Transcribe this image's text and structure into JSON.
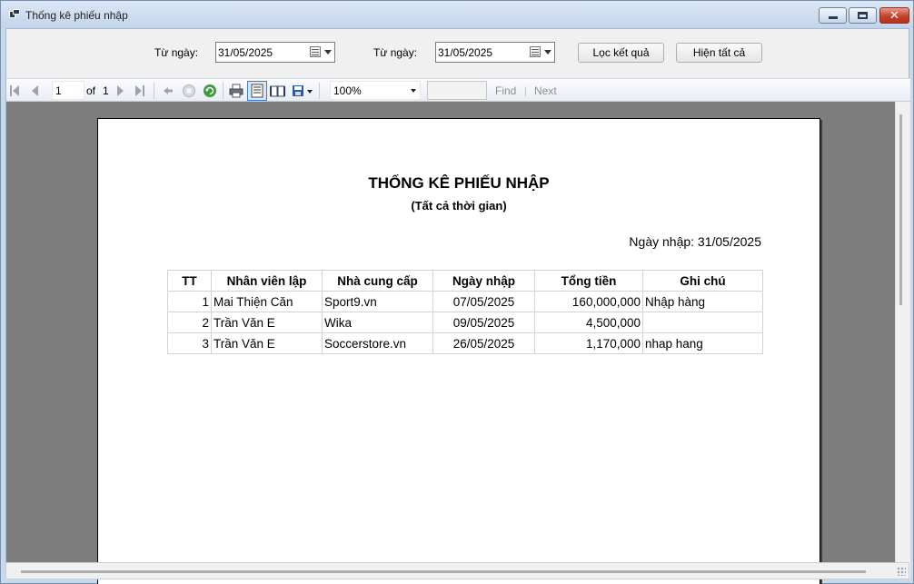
{
  "window": {
    "title": "Thống kê phiếu nhập"
  },
  "filters": {
    "from_label": "Từ ngày:",
    "from_value": "31/05/2025",
    "to_label": "Từ ngày:",
    "to_value": "31/05/2025",
    "filter_button": "Lọc kết quả",
    "show_all_button": "Hiện tất cả"
  },
  "toolbar": {
    "page_current": "1",
    "page_of_label": "of",
    "page_total": "1",
    "zoom": "100%",
    "find_label": "Find",
    "find_sep": "|",
    "next_label": "Next",
    "icons": [
      "first-page-icon",
      "prev-page-icon",
      "next-page-icon",
      "last-page-icon",
      "back-icon",
      "stop-icon",
      "refresh-icon",
      "print-icon",
      "print-layout-icon",
      "page-setup-icon",
      "export-icon"
    ]
  },
  "report": {
    "title": "THỐNG KÊ PHIẾU NHẬP",
    "subtitle": "(Tất cả thời gian)",
    "date_line": "Ngày nhập: 31/05/2025",
    "columns": [
      "TT",
      "Nhân viên lập",
      "Nhà cung cấp",
      "Ngày nhập",
      "Tổng tiền",
      "Ghi chú"
    ],
    "rows": [
      [
        "1",
        "Mai Thiện Căn",
        "Sport9.vn",
        "07/05/2025",
        "160,000,000",
        "Nhập hàng"
      ],
      [
        "2",
        "Trần Văn E",
        "Wika",
        "09/05/2025",
        "4,500,000",
        ""
      ],
      [
        "3",
        "Trần Văn E",
        "Soccerstore.vn",
        "26/05/2025",
        "1,170,000",
        "nhap hang"
      ]
    ]
  },
  "colors": {
    "titlebar": "#c3d4ea",
    "close_button": "#c4432c",
    "viewer_background": "#7d7d7d"
  }
}
